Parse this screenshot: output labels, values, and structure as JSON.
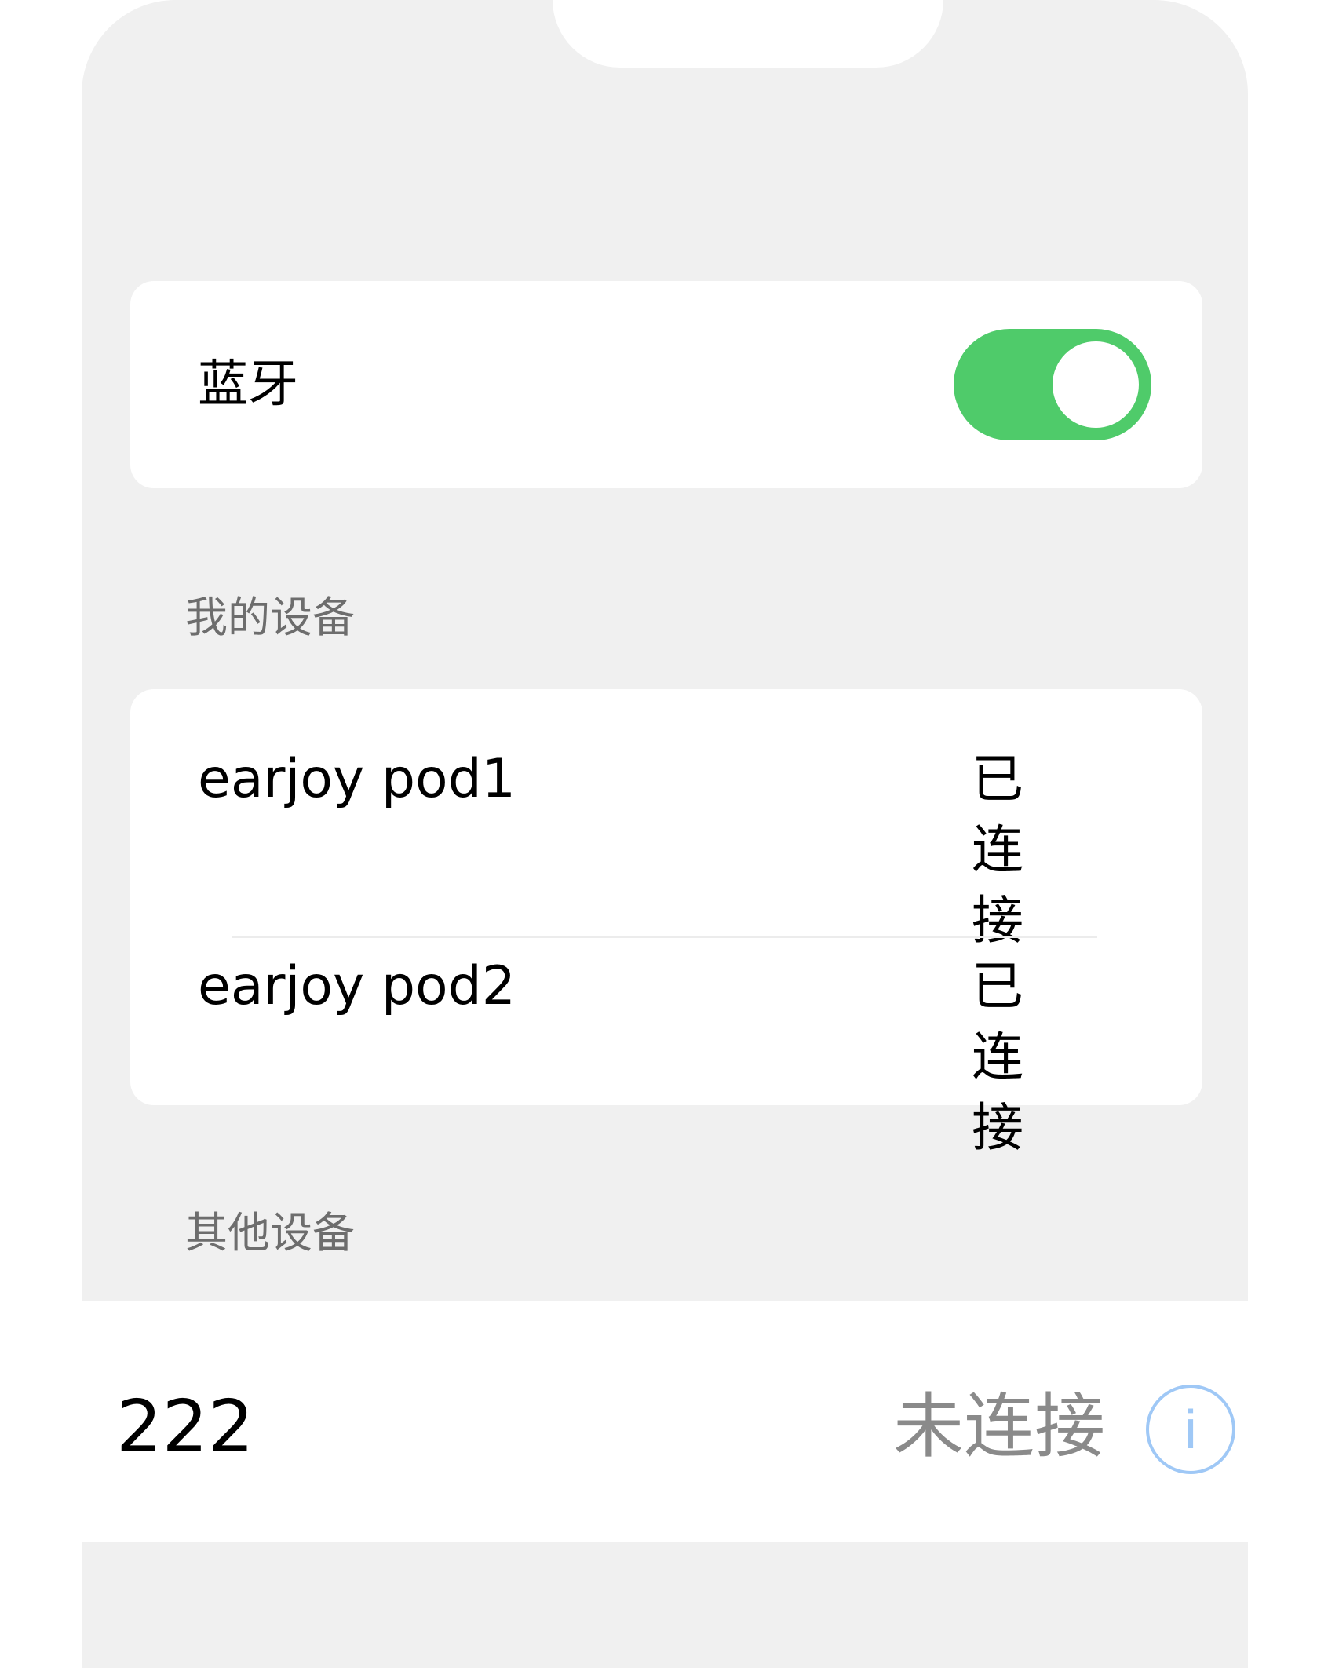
{
  "bluetooth": {
    "label": "蓝牙",
    "enabled": true
  },
  "my_devices": {
    "title": "我的设备",
    "items": [
      {
        "name": "earjoy pod1",
        "status": "已连接"
      },
      {
        "name": "earjoy pod2",
        "status": "已连接"
      }
    ]
  },
  "other_devices": {
    "title": "其他设备",
    "items": [
      {
        "name": "222",
        "status": "未连接",
        "info_icon": "info-icon",
        "info_glyph": "i"
      }
    ]
  },
  "colors": {
    "toggle_on": "#4fcb6a",
    "background": "#f0f0f0",
    "info_icon": "#9fc8f6",
    "secondary_text": "#8a8a8a"
  }
}
